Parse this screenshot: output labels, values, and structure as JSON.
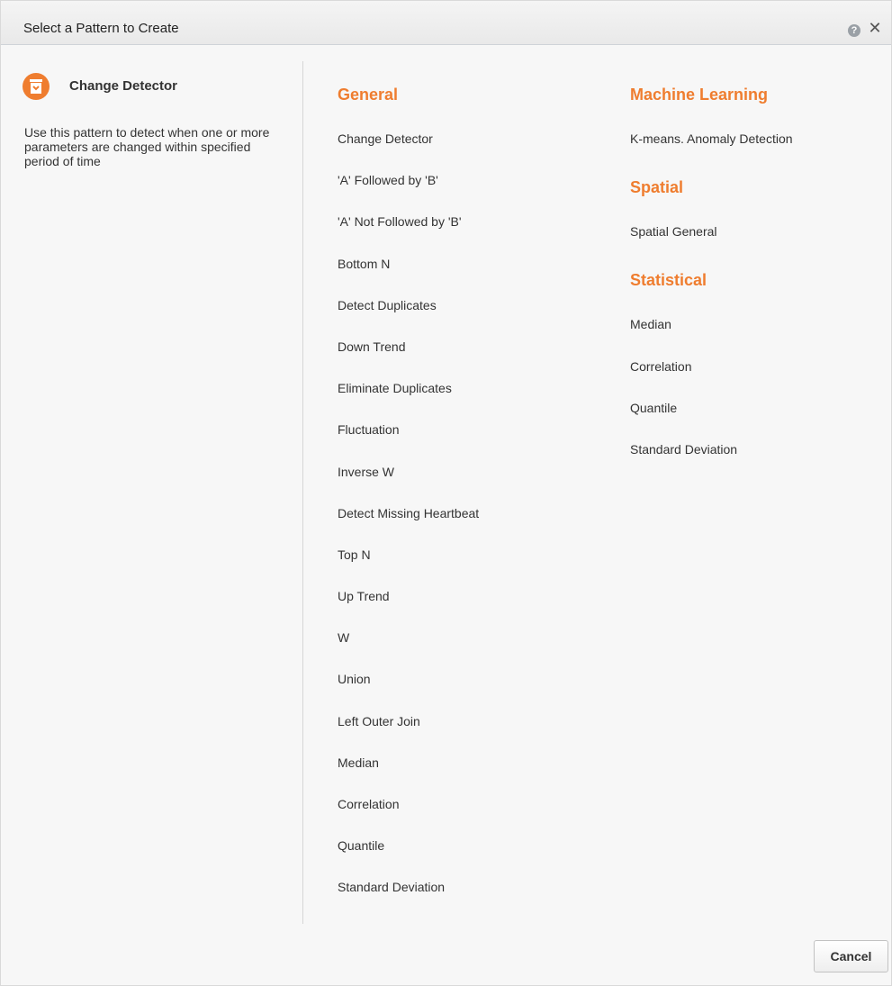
{
  "dialog": {
    "title": "Select a Pattern to Create",
    "help_icon": "help-icon",
    "help_glyph": "?",
    "close_icon": "close-icon",
    "close_glyph": "✕"
  },
  "selected_pattern": {
    "icon": "change-detector-icon",
    "name": "Change Detector",
    "description": "Use this pattern to detect when one or more parameters are changed within specified period of time"
  },
  "categories": {
    "general": {
      "heading": "General",
      "items": [
        "Change Detector",
        "'A' Followed by 'B'",
        "'A' Not Followed by 'B'",
        "Bottom N",
        "Detect Duplicates",
        "Down Trend",
        "Eliminate Duplicates",
        "Fluctuation",
        "Inverse W",
        "Detect Missing Heartbeat",
        "Top N",
        "Up Trend",
        "W",
        "Union",
        "Left Outer Join",
        "Median",
        "Correlation",
        "Quantile",
        "Standard Deviation"
      ]
    },
    "machine_learning": {
      "heading": "Machine Learning",
      "items": [
        "K-means. Anomaly Detection"
      ]
    },
    "spatial": {
      "heading": "Spatial",
      "items": [
        "Spatial General"
      ]
    },
    "statistical": {
      "heading": "Statistical",
      "items": [
        "Median",
        "Correlation",
        "Quantile",
        "Standard Deviation"
      ]
    }
  },
  "footer": {
    "cancel_label": "Cancel"
  },
  "colors": {
    "accent": "#ef7d2f",
    "text": "#333333",
    "background": "#f7f7f7"
  }
}
